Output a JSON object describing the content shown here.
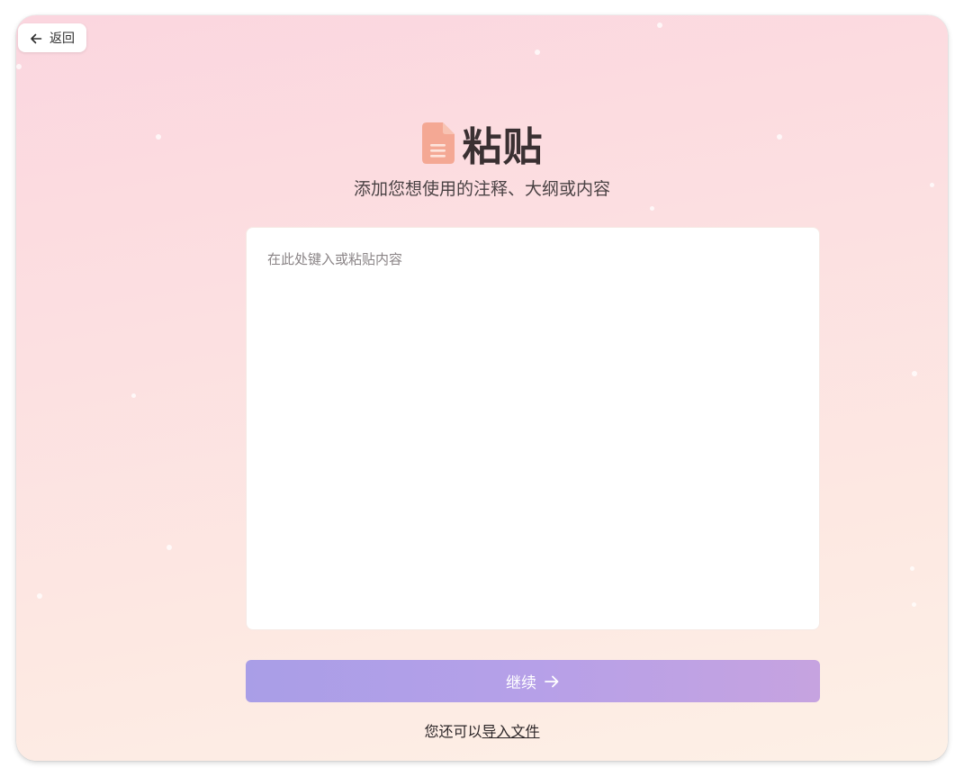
{
  "back_button": {
    "label": "返回",
    "icon": "arrow-left-icon"
  },
  "header": {
    "icon": "document-icon",
    "title": "粘贴",
    "subtitle": "添加您想使用的注释、大纲或内容"
  },
  "editor": {
    "placeholder": "在此处键入或粘贴内容",
    "value": ""
  },
  "continue_button": {
    "label": "继续",
    "icon": "arrow-right-icon"
  },
  "import": {
    "prefix": "您还可以",
    "link_label": "导入文件"
  },
  "colors": {
    "accent_gradient_start": "#a99ee7",
    "accent_gradient_end": "#c6a3e0",
    "doc_icon": "#f4a894",
    "background_top": "#fbd6df",
    "background_bottom": "#fdf0e6"
  }
}
